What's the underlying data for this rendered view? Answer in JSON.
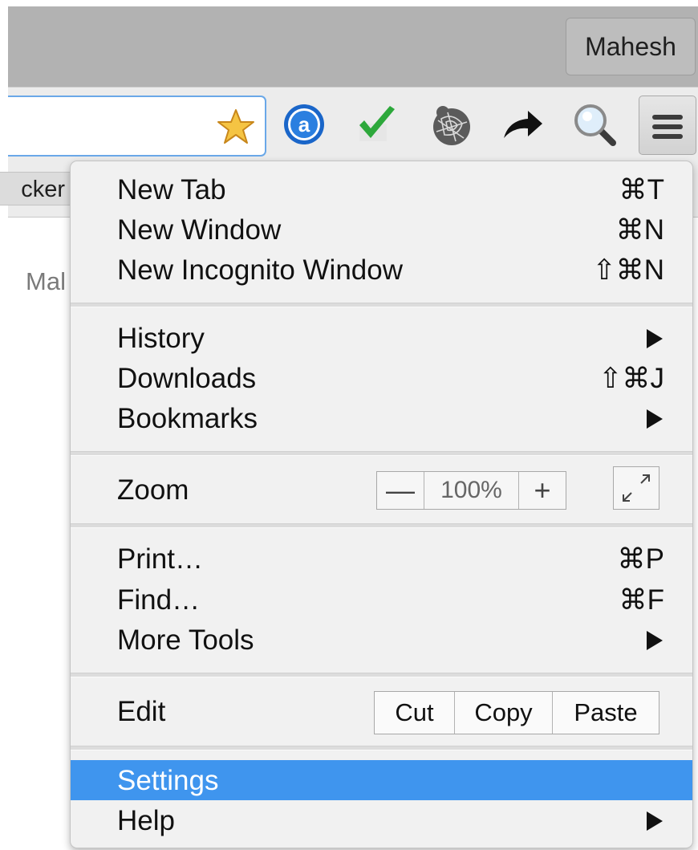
{
  "window": {
    "profile_name": "Mahesh"
  },
  "toolbar": {
    "extensions": [
      "amazon-assistant-icon",
      "checkmark-icon",
      "spider-web-icon",
      "share-arrow-icon",
      "magnifier-icon"
    ]
  },
  "bookmarks_bar": {
    "item_label": "cker"
  },
  "page": {
    "clipped_text": "Mal"
  },
  "menu": {
    "group1": [
      {
        "label": "New Tab",
        "shortcut": "⌘T"
      },
      {
        "label": "New Window",
        "shortcut": "⌘N"
      },
      {
        "label": "New Incognito Window",
        "shortcut": "⇧⌘N"
      }
    ],
    "group2": [
      {
        "label": "History",
        "submenu": true
      },
      {
        "label": "Downloads",
        "shortcut": "⇧⌘J"
      },
      {
        "label": "Bookmarks",
        "submenu": true
      }
    ],
    "zoom": {
      "label": "Zoom",
      "minus": "—",
      "value": "100%",
      "plus": "+"
    },
    "group4": [
      {
        "label": "Print…",
        "shortcut": "⌘P"
      },
      {
        "label": "Find…",
        "shortcut": "⌘F"
      },
      {
        "label": "More Tools",
        "submenu": true
      }
    ],
    "edit": {
      "label": "Edit",
      "cut": "Cut",
      "copy": "Copy",
      "paste": "Paste"
    },
    "group6": [
      {
        "label": "Settings",
        "highlighted": true
      },
      {
        "label": "Help",
        "submenu": true
      }
    ]
  },
  "colors": {
    "highlight": "#3f95ee",
    "omnibox_focus": "#6aa8e8"
  }
}
